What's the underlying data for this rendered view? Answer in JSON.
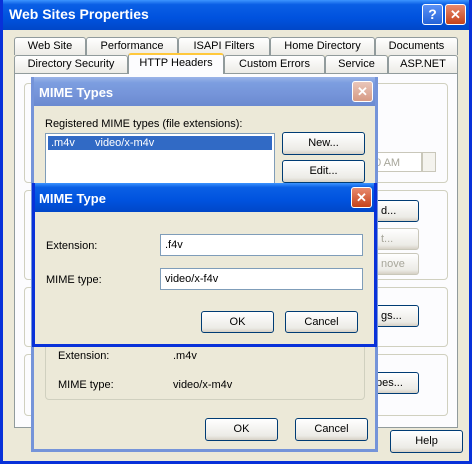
{
  "main_window": {
    "title": "Web Sites Properties",
    "help_glyph": "?",
    "close_glyph": "✕",
    "tabs_row1": [
      "Web Site",
      "Performance",
      "ISAPI Filters",
      "Home Directory",
      "Documents"
    ],
    "tabs_row2": [
      "Directory Security",
      "HTTP Headers",
      "Custom Errors",
      "Service",
      "ASP.NET"
    ],
    "active_tab": "HTTP Headers",
    "partial_time": "0 AM",
    "btn_partial_1": "d...",
    "btn_partial_2": "t...",
    "btn_partial_3": "nove",
    "btn_partial_4": "gs...",
    "btn_partial_5": "pes...",
    "help_button": "Help"
  },
  "mime_types_dialog": {
    "title": "MIME Types",
    "close_glyph": "✕",
    "registered_label": "Registered MIME types (file extensions):",
    "list": [
      {
        "ext": ".m4v",
        "type": "video/x-m4v"
      }
    ],
    "new_button": "New...",
    "edit_button": "Edit...",
    "extension_label": "Extension:",
    "extension_value": ".m4v",
    "mime_label": "MIME type:",
    "mime_value": "video/x-m4v",
    "ok_button": "OK",
    "cancel_button": "Cancel"
  },
  "mime_type_dialog": {
    "title": "MIME Type",
    "close_glyph": "✕",
    "extension_label": "Extension:",
    "extension_value": ".f4v",
    "mime_label": "MIME type:",
    "mime_value": "video/x-f4v",
    "ok_button": "OK",
    "cancel_button": "Cancel"
  }
}
